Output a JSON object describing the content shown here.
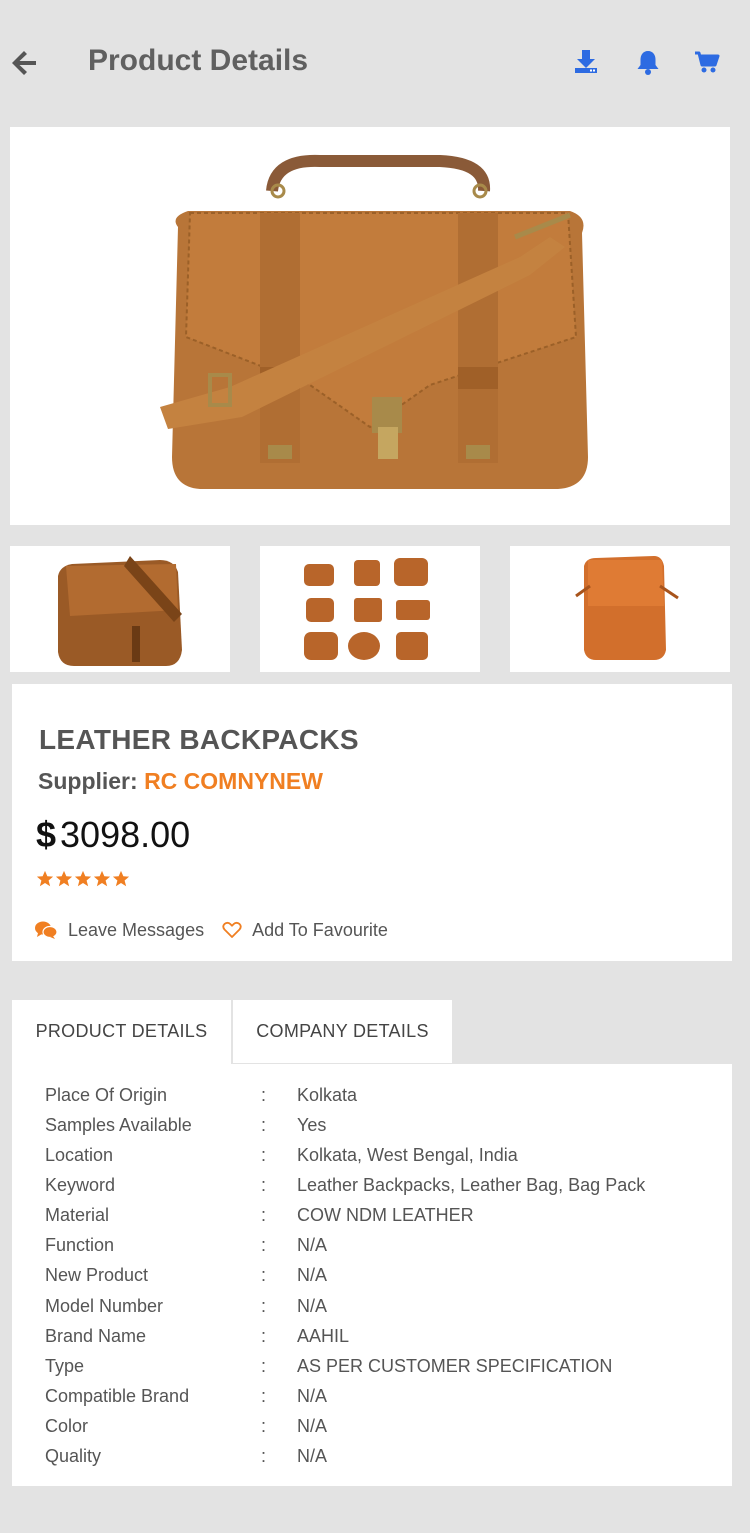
{
  "header": {
    "title": "Product Details",
    "icon_color": "#2d6be2"
  },
  "product": {
    "name": "LEATHER BACKPACKS",
    "supplier_label": "Supplier:",
    "supplier_name": "RC COMNYNEW",
    "currency": "$",
    "price": "3098.00",
    "rating": 5,
    "rating_max": 5
  },
  "actions": {
    "leave_messages": "Leave Messages",
    "add_favourite": "Add To Favourite"
  },
  "tabs": [
    {
      "label": "PRODUCT DETAILS"
    },
    {
      "label": "COMPANY DETAILS"
    }
  ],
  "details": [
    {
      "label": "Place Of Origin",
      "value": "Kolkata"
    },
    {
      "label": "Samples Available",
      "value": "Yes"
    },
    {
      "label": "Location",
      "value": "Kolkata, West Bengal, India"
    },
    {
      "label": "Keyword",
      "value": "Leather Backpacks, Leather Bag, Bag Pack"
    },
    {
      "label": "Material",
      "value": "COW NDM LEATHER"
    },
    {
      "label": "Function",
      "value": "N/A"
    },
    {
      "label": "New Product",
      "value": "N/A"
    },
    {
      "label": "Model Number",
      "value": "N/A"
    },
    {
      "label": "Brand Name",
      "value": "AAHIL"
    },
    {
      "label": "Type",
      "value": "AS PER CUSTOMER SPECIFICATION"
    },
    {
      "label": "Compatible Brand",
      "value": "N/A"
    },
    {
      "label": "Color",
      "value": "N/A"
    },
    {
      "label": "Quality",
      "value": "N/A"
    }
  ],
  "separator": ":",
  "colors": {
    "accent": "#f07f22",
    "header_icons": "#2d6be2",
    "background": "#e3e3e3"
  }
}
